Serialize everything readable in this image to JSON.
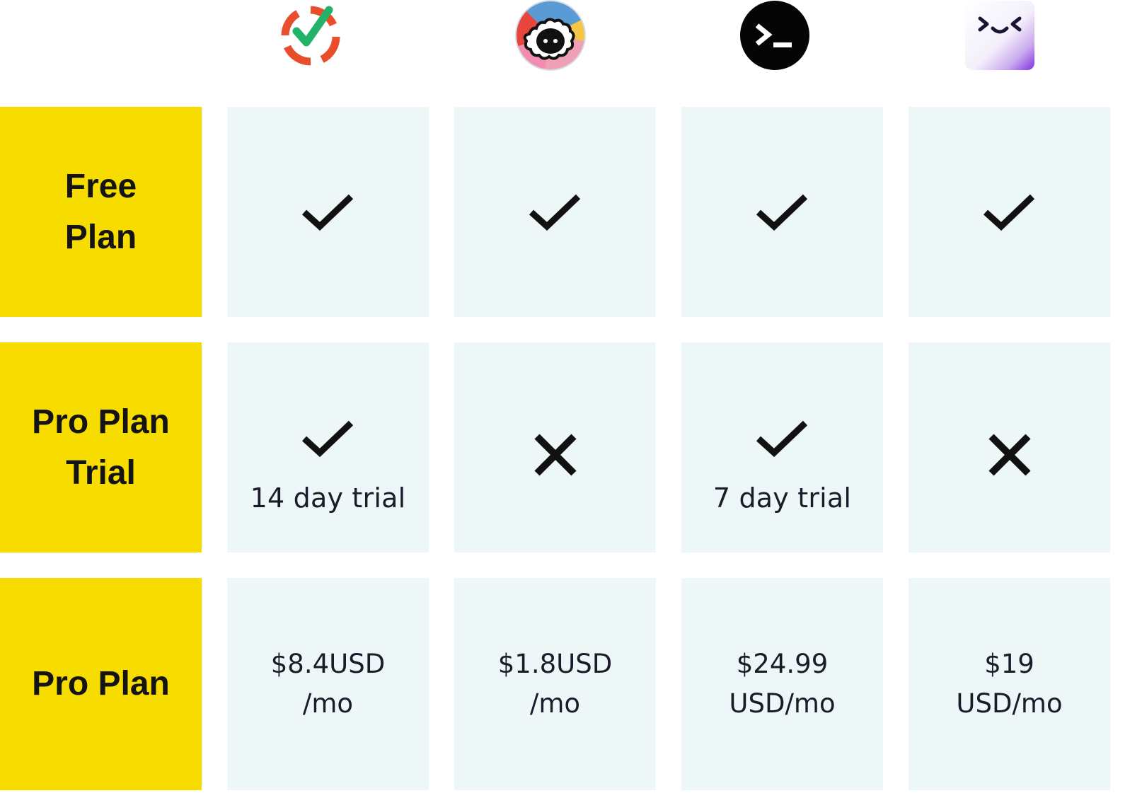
{
  "products": [
    {
      "icon": "red-ring-checkmark-icon"
    },
    {
      "icon": "sheep-face-icon"
    },
    {
      "icon": "terminal-prompt-icon"
    },
    {
      "icon": "smiling-face-icon"
    }
  ],
  "rows": [
    {
      "label": "Free\nPlan",
      "cells": [
        "check",
        "check",
        "check",
        "check"
      ]
    },
    {
      "label": "Pro Plan\nTrial",
      "cells": [
        "check",
        "cross",
        "check",
        "cross"
      ],
      "notes": [
        "14 day trial",
        "",
        "7 day trial",
        ""
      ]
    },
    {
      "label": "Pro Plan",
      "prices": [
        "$8.4USD\n/mo",
        "$1.8USD\n/mo",
        "$24.99\nUSD/mo",
        "$19\nUSD/mo"
      ]
    }
  ]
}
